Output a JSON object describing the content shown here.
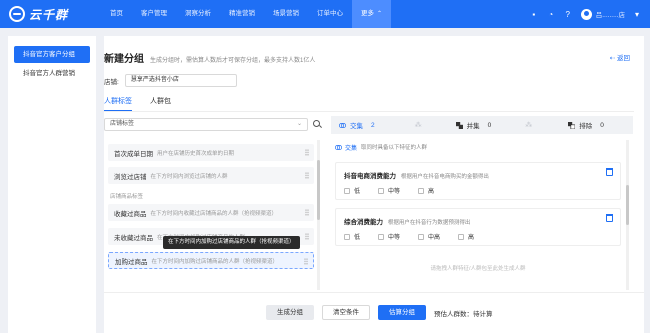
{
  "app": {
    "logo_text": "云千群"
  },
  "nav": {
    "items": [
      "首页",
      "客户管理",
      "洞察分析",
      "精准营销",
      "场景营销",
      "订单中心"
    ],
    "more_label": "更多",
    "active_label": "更多"
  },
  "topbar": {
    "user_name": "吕.........店"
  },
  "sidebar": {
    "items": [
      {
        "label": "抖音官方客户分组",
        "active": true
      },
      {
        "label": "抖音官方人群营销",
        "active": false
      }
    ]
  },
  "page": {
    "title": "新建分组",
    "description": "生成分组时，需估算人数后才可保存分组，最多支持人数1亿人",
    "back_label": "返回",
    "shop_label": "店铺:",
    "shop_value": "慧享严选抖音小店"
  },
  "tabs": [
    {
      "label": "人群标签",
      "active": true
    },
    {
      "label": "人群包",
      "active": false
    }
  ],
  "search": {
    "value": "店铺标签"
  },
  "ops": {
    "intersect_label": "交集",
    "intersect_count": "2",
    "union_label": "并集",
    "union_count": "0",
    "exclude_label": "排除",
    "exclude_count": "0"
  },
  "attributes": {
    "items": [
      {
        "name": "首次成单日期",
        "desc": "用户在店铺历史首次成单的日期"
      },
      {
        "name": "浏览过店铺",
        "desc": "在下方时间内浏览过店铺的人群"
      }
    ],
    "group_label": "店铺商品标签",
    "group_items": [
      {
        "name": "收藏过商品",
        "desc": "在下方时间内收藏过店铺商品的人群（抢视频渠道）"
      },
      {
        "name": "未收藏过商品",
        "desc": "在下方时间内加购过店铺商品的人群"
      },
      {
        "name": "加购过商品",
        "desc": "在下方时间内加购过店铺商品的人群（抢视频渠道）"
      }
    ],
    "tooltip": "在下方时间内加购过店铺商品的人群（抢视频渠道）"
  },
  "conditions": {
    "badge": "交集",
    "hint": "取同时具备以下特征的人群",
    "cards": [
      {
        "title": "抖音电商消费能力",
        "desc": "根据用户在抖音电商购买的金额得出",
        "options": [
          "低",
          "中等",
          "高"
        ]
      },
      {
        "title": "综合消费能力",
        "desc": "根据用户在抖音行为数据预测得出",
        "options": [
          "低",
          "中等",
          "中高",
          "高"
        ]
      }
    ],
    "drop_hint": "请拖拽人群特征/人群包至此处生成人群"
  },
  "footer": {
    "generate_label": "生成分组",
    "clear_label": "清空条件",
    "estimate_label": "估算分组",
    "estimate_text": "预估人群数：待计算"
  },
  "colors": {
    "primary": "#1f6ff5",
    "nav_active": "#4d8dff"
  }
}
